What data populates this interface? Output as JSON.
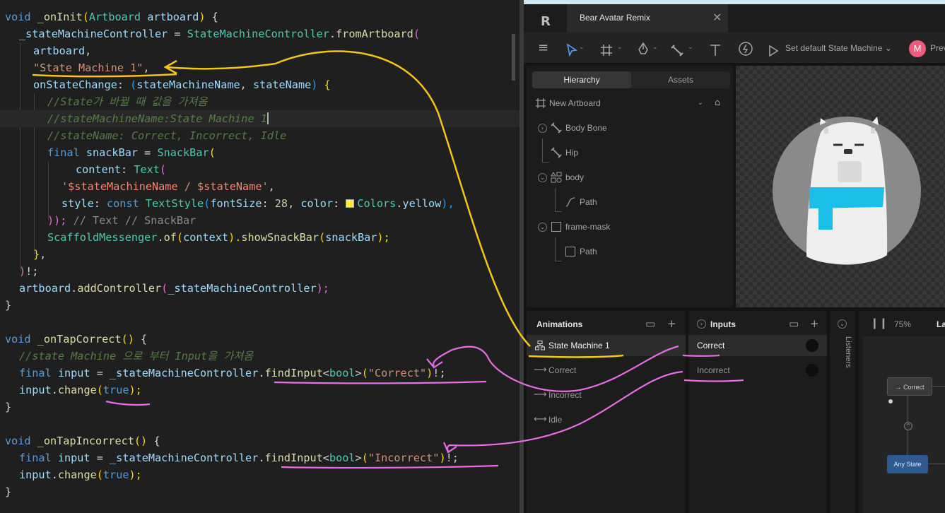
{
  "editor": {
    "lines": {
      "l1": {
        "a": "void",
        "b": " _onInit",
        "c": "(",
        "d": "Artboard",
        "e": " artboard",
        "f": ")",
        "g": " {"
      },
      "l2": {
        "a": "_stateMachineController",
        "b": " = ",
        "c": "StateMachineController",
        "d": ".",
        "e": "fromArtboard",
        "f": "("
      },
      "l3": {
        "a": "artboard",
        "b": ","
      },
      "l4": {
        "a": "\"State Machine 1\"",
        "b": ","
      },
      "l5": {
        "a": "onStateChange",
        "b": ": ",
        "c": "(",
        "d": "stateMachineName",
        "e": ", ",
        "f": "stateName",
        "g": ") ",
        "h": "{"
      },
      "l6": {
        "a": "//State가 바뀔 때 값을 가져옴"
      },
      "l7": {
        "a": "//stateMachineName:State Machine 1"
      },
      "l8": {
        "a": "//stateName: Correct, Incorrect, Idle"
      },
      "l9": {
        "a": "final",
        "b": " snackBar",
        "c": " = ",
        "d": "SnackBar",
        "e": "("
      },
      "l10": {
        "a": "content",
        "b": ": ",
        "c": "Text",
        "d": "("
      },
      "l11": {
        "a": "'",
        "b": "$stateMachineName",
        "c": " / ",
        "d": "$stateName",
        "e": "'",
        "f": ","
      },
      "l12": {
        "a": "style",
        "b": ": ",
        "c": "const",
        "d": " TextStyle",
        "e": "(",
        "f": "fontSize",
        "g": ": ",
        "h": "28",
        "i": ", ",
        "j": "color",
        "k": ": ",
        "l": "Colors",
        "m": ".",
        "n": "yellow",
        "o": "),"
      },
      "l13": {
        "a": "));",
        "b": " // Text // SnackBar"
      },
      "l14": {
        "a": "ScaffoldMessenger",
        "b": ".",
        "c": "of",
        "d": "(",
        "e": "context",
        "f": ").",
        "g": "showSnackBar",
        "h": "(",
        "i": "snackBar",
        "j": ");"
      },
      "l15": {
        "a": "}",
        "b": ","
      },
      "l16": {
        "a": ")",
        "b": "!;"
      },
      "l17": {
        "a": "artboard",
        "b": ".",
        "c": "addController",
        "d": "(",
        "e": "_stateMachineController",
        "f": ");"
      },
      "l18": {
        "a": "}"
      },
      "l20": {
        "a": "void",
        "b": " _onTapCorrect",
        "c": "()",
        "d": " {"
      },
      "l21": {
        "a": "//state Machine 으로 부터 Input을 가져옴"
      },
      "l22": {
        "a": "final",
        "b": " input",
        "c": " = ",
        "d": "_stateMachineController",
        "e": ".",
        "f": "findInput",
        "g": "<",
        "h": "bool",
        "i": ">",
        "j": "(",
        "k": "\"Correct\"",
        "l": ")",
        "m": "!;"
      },
      "l23": {
        "a": "input",
        "b": ".",
        "c": "change",
        "d": "(",
        "e": "true",
        "f": ");"
      },
      "l24": {
        "a": "}"
      },
      "l26": {
        "a": "void",
        "b": " _onTapIncorrect",
        "c": "()",
        "d": " {"
      },
      "l27": {
        "a": "final",
        "b": " input",
        "c": " = ",
        "d": "_stateMachineController",
        "e": ".",
        "f": "findInput",
        "g": "<",
        "h": "bool",
        "i": ">",
        "j": "(",
        "k": "\"Incorrect\"",
        "l": ")",
        "m": "!;"
      },
      "l28": {
        "a": "input",
        "b": ".",
        "c": "change",
        "d": "(",
        "e": "true",
        "f": ");"
      },
      "l29": {
        "a": "}"
      }
    }
  },
  "rive": {
    "logo": "R",
    "doc_tab": {
      "title": "Bear Avatar Remix",
      "close": "✕"
    },
    "toolbar": {
      "set_default_sm": "Set default State Machine",
      "avatar_initial": "M",
      "preview_label": "Prev"
    },
    "hierarchy": {
      "tabs": [
        "Hierarchy",
        "Assets"
      ],
      "items": [
        {
          "label": "New Artboard",
          "icon": "artboard-icon"
        },
        {
          "label": "Body Bone",
          "icon": "bone-icon"
        },
        {
          "label": "Hip",
          "icon": "bone-icon"
        },
        {
          "label": "body",
          "icon": "group-icon"
        },
        {
          "label": "Path",
          "icon": "path-icon"
        },
        {
          "label": "frame-mask",
          "icon": "shape-icon"
        },
        {
          "label": "Path",
          "icon": "shape-icon"
        }
      ]
    },
    "animations": {
      "title": "Animations",
      "items": [
        {
          "label": "State Machine 1",
          "icon": "state-machine-icon"
        },
        {
          "label": "Correct",
          "icon": "arrow-right-icon"
        },
        {
          "label": "Incorrect",
          "icon": "arrow-right-icon"
        },
        {
          "label": "Idle",
          "icon": "arrows-both-icon"
        }
      ]
    },
    "inputs": {
      "title": "Inputs",
      "items": [
        {
          "label": "Correct"
        },
        {
          "label": "Incorrect"
        }
      ]
    },
    "listeners": {
      "title": "Listeners"
    },
    "graph": {
      "zoom": "75%",
      "tab_label": "La",
      "nodes": {
        "correct": "→ Correct",
        "any_state": "Any State"
      }
    }
  },
  "colors": {
    "annotation_yellow": "#f5c518",
    "annotation_pink": "#e86ce8",
    "accent_avatar": "#f05a7e"
  }
}
